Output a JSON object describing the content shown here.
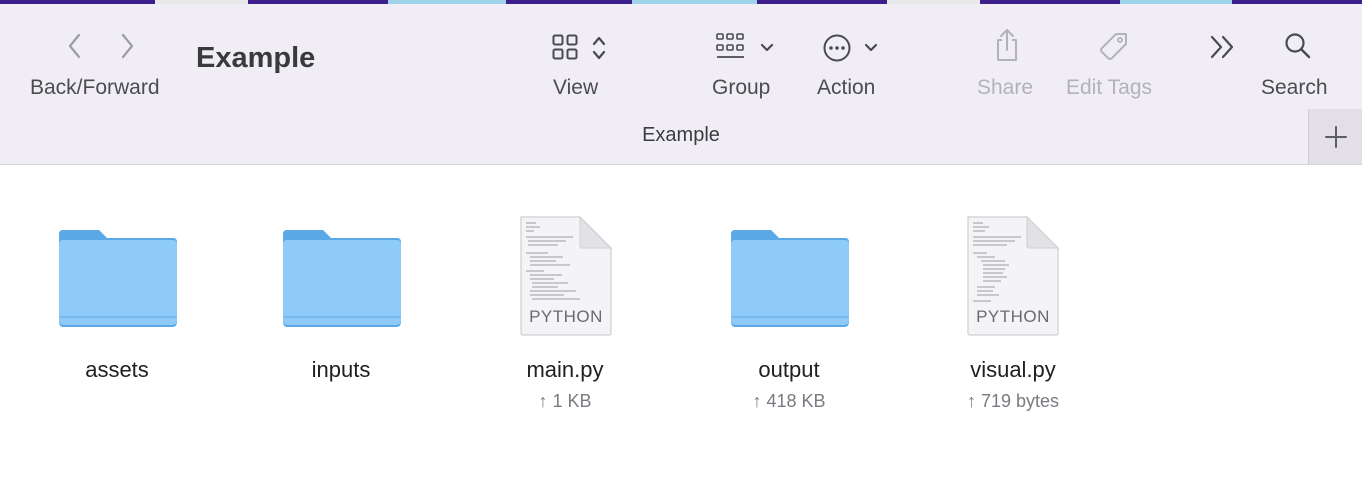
{
  "window": {
    "title": "Example",
    "path_label": "Example"
  },
  "toolbar": {
    "back_forward_label": "Back/Forward",
    "view_label": "View",
    "group_label": "Group",
    "action_label": "Action",
    "share_label": "Share",
    "edit_tags_label": "Edit Tags",
    "search_label": "Search"
  },
  "files": [
    {
      "name": "assets",
      "kind": "folder",
      "meta": ""
    },
    {
      "name": "inputs",
      "kind": "folder",
      "meta": ""
    },
    {
      "name": "main.py",
      "kind": "python",
      "badge": "PYTHON",
      "meta": "↑ 1 KB"
    },
    {
      "name": "output",
      "kind": "folder",
      "meta": "↑ 418 KB"
    },
    {
      "name": "visual.py",
      "kind": "python",
      "badge": "PYTHON",
      "meta": "↑ 719 bytes"
    }
  ],
  "colors": {
    "folder_light": "#8ecbf8",
    "folder_dark": "#5aa9e6",
    "toolbar_bg": "#f0eef4"
  }
}
